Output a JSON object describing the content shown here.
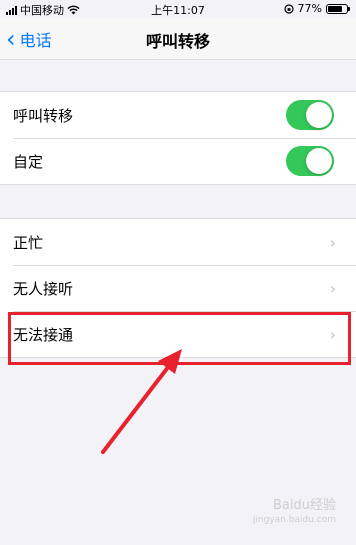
{
  "status_bar": {
    "carrier": "中国移动",
    "time": "上午11:07",
    "battery": "77%",
    "battery_level": 0.77
  },
  "nav": {
    "back_label": "电话",
    "title": "呼叫转移"
  },
  "toggle_group": {
    "items": [
      {
        "label": "呼叫转移",
        "on": true
      },
      {
        "label": "自定",
        "on": true
      }
    ]
  },
  "conditions_group": {
    "items": [
      {
        "label": "正忙"
      },
      {
        "label": "无人接听"
      },
      {
        "label": "无法接通"
      }
    ]
  },
  "colors": {
    "accent": "#007aff",
    "toggle_on": "#34c759",
    "annotation": "#e8212e"
  },
  "watermark": {
    "text": "Baidu经验",
    "sub": "jingyan.baidu.com"
  }
}
